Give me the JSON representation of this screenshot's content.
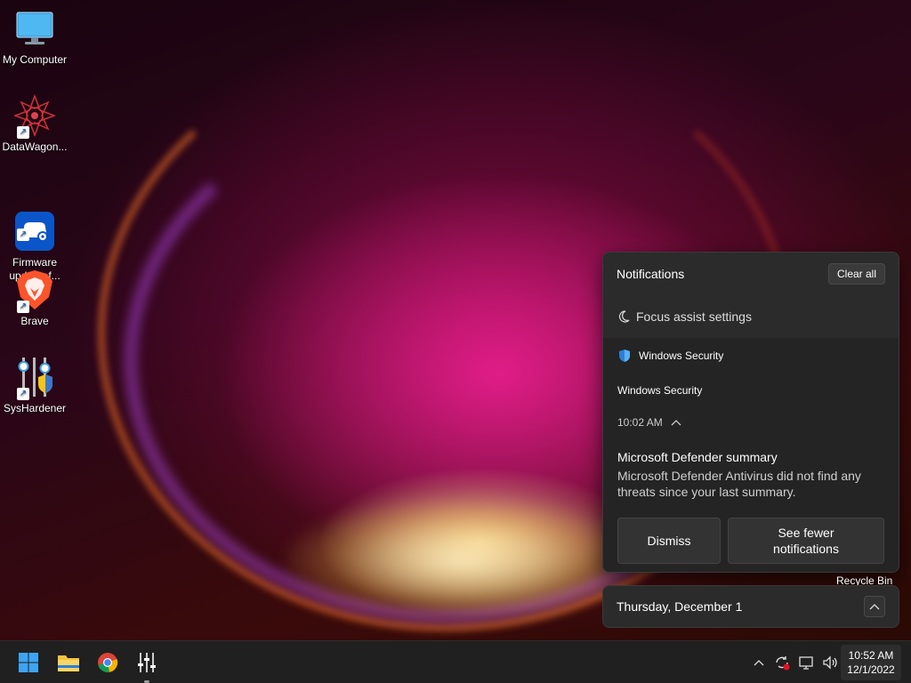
{
  "desktop": {
    "icons": [
      {
        "label": "My Computer",
        "icon": "monitor-icon",
        "shortcut": false
      },
      {
        "label": "DataWagon...",
        "icon": "datawagon-app-icon",
        "shortcut": true
      },
      {
        "label": "Firmware\nupdater f...",
        "icon": "gamepad-settings-icon",
        "shortcut": true
      },
      {
        "label": "Brave",
        "icon": "brave-lion-icon",
        "shortcut": true
      },
      {
        "label": "SysHardener",
        "icon": "sliders-shield-icon",
        "shortcut": true
      }
    ],
    "recycle_bin_label": "Recycle Bin"
  },
  "notifications": {
    "title": "Notifications",
    "clear_all": "Clear all",
    "focus_assist": "Focus assist settings",
    "toast": {
      "app_name": "Windows Security",
      "source": "Windows Security",
      "time": "10:02 AM",
      "heading": "Microsoft Defender summary",
      "body": "Microsoft Defender Antivirus did not find any threats since your last summary.",
      "dismiss": "Dismiss",
      "see_fewer": "See fewer notifications"
    }
  },
  "calendar": {
    "date": "Thursday, December 1"
  },
  "taskbar": {
    "apps": [
      "windows-start-icon",
      "file-explorer-icon",
      "chrome-icon",
      "syshardener-icon"
    ],
    "clock_time": "10:52 AM",
    "clock_date": "12/1/2022"
  },
  "colors": {
    "panel_bg": "#2b2b2b",
    "taskbar_bg": "#202020",
    "accent_blue": "#0078d4"
  }
}
